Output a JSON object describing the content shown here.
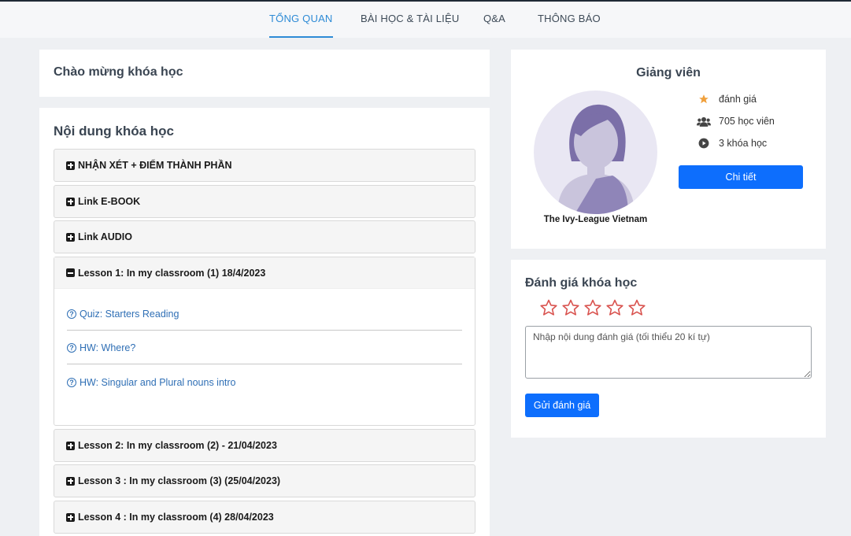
{
  "tabs": [
    {
      "label": "TỔNG QUAN"
    },
    {
      "label": "BÀI HỌC & TÀI LIỆU"
    },
    {
      "label": "Q&A"
    },
    {
      "label": "THÔNG BÁO"
    }
  ],
  "welcome": {
    "title": "Chào mừng khóa học"
  },
  "content": {
    "title": "Nội dung khóa học",
    "sections": [
      {
        "label": "NHẬN XÉT + ĐIỂM THÀNH PHẦN"
      },
      {
        "label": "Link E-BOOK"
      },
      {
        "label": "Link AUDIO"
      },
      {
        "label": "Lesson 1: In my classroom (1) 18/4/2023",
        "items": [
          {
            "label": "Quiz: Starters Reading"
          },
          {
            "label": "HW: Where?"
          },
          {
            "label": "HW: Singular and Plural nouns intro"
          }
        ]
      },
      {
        "label": "Lesson 2: In my classroom (2) - 21/04/2023"
      },
      {
        "label": "Lesson 3 : In my classroom (3) (25/04/2023)"
      },
      {
        "label": "Lesson 4 : In my classroom (4) 28/04/2023"
      }
    ]
  },
  "instructor": {
    "title": "Giảng viên",
    "name": "The Ivy-League Vietnam",
    "rating_label": "đánh giá",
    "students": "705 học viên",
    "courses": "3 khóa học",
    "detail_button": "Chi tiết"
  },
  "review": {
    "title": "Đánh giá khóa học",
    "placeholder": "Nhập nội dung đánh giá (tối thiểu 20 kí tự)",
    "submit": "Gửi đánh giá"
  },
  "colors": {
    "accent": "#2e8bd6",
    "primary_button": "#0d6efd",
    "link": "#2f6fb5",
    "star_outline": "#d9534f",
    "rating_star": "#f0a03c"
  }
}
